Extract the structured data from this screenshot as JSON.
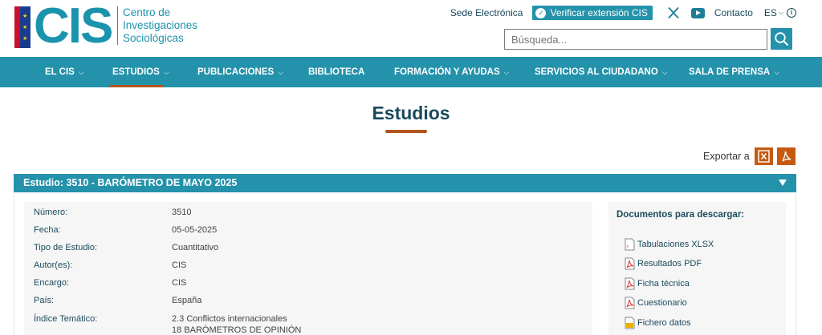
{
  "logo": {
    "acronym": "CIS",
    "line1": "Centro de",
    "line2": "Investigaciones",
    "line3": "Sociológicas"
  },
  "top_links": {
    "sede": "Sede Electrónica",
    "verificar": "Verificar extensión CIS",
    "contacto": "Contacto",
    "language": "ES"
  },
  "search": {
    "placeholder": "Búsqueda..."
  },
  "nav": {
    "items": [
      {
        "label": "EL CIS",
        "has_dropdown": true
      },
      {
        "label": "ESTUDIOS",
        "has_dropdown": true
      },
      {
        "label": "PUBLICACIONES",
        "has_dropdown": true
      },
      {
        "label": "BIBLIOTECA",
        "has_dropdown": false
      },
      {
        "label": "FORMACIÓN Y AYUDAS",
        "has_dropdown": true
      },
      {
        "label": "SERVICIOS AL CIUDADANO",
        "has_dropdown": true
      },
      {
        "label": "SALA DE PRENSA",
        "has_dropdown": true
      }
    ],
    "active": "ESTUDIOS"
  },
  "page": {
    "title": "Estudios",
    "export_label": "Exportar a"
  },
  "study": {
    "header": "Estudio: 3510 - BARÓMETRO DE MAYO 2025",
    "fields": [
      {
        "label": "Número:",
        "value": "3510"
      },
      {
        "label": "Fecha:",
        "value": "05-05-2025"
      },
      {
        "label": "Tipo de Estudio:",
        "value": "Cuantitativo"
      },
      {
        "label": "Autor(es):",
        "value": "CIS"
      },
      {
        "label": "Encargo:",
        "value": "CIS"
      },
      {
        "label": "País:",
        "value": "España"
      },
      {
        "label": "Índice Temático:",
        "value": "2.3 Conflictos internacionales",
        "value2": "18 BARÓMETROS DE OPINIÓN"
      }
    ]
  },
  "downloads": {
    "title": "Documentos para descargar:",
    "items": [
      {
        "label": "Tabulaciones XLSX",
        "icon": "xlsx-file-icon"
      },
      {
        "label": "Resultados PDF",
        "icon": "pdf-file-icon"
      },
      {
        "label": "Ficha técnica",
        "icon": "pdf-file-icon"
      },
      {
        "label": "Cuestionario",
        "icon": "pdf-file-icon"
      },
      {
        "label": "Fichero datos",
        "icon": "data-file-icon"
      }
    ]
  },
  "colors": {
    "primary": "#2492ab",
    "accent": "#b1541c",
    "export": "#c55a11",
    "text_dark": "#1b4a5c"
  }
}
